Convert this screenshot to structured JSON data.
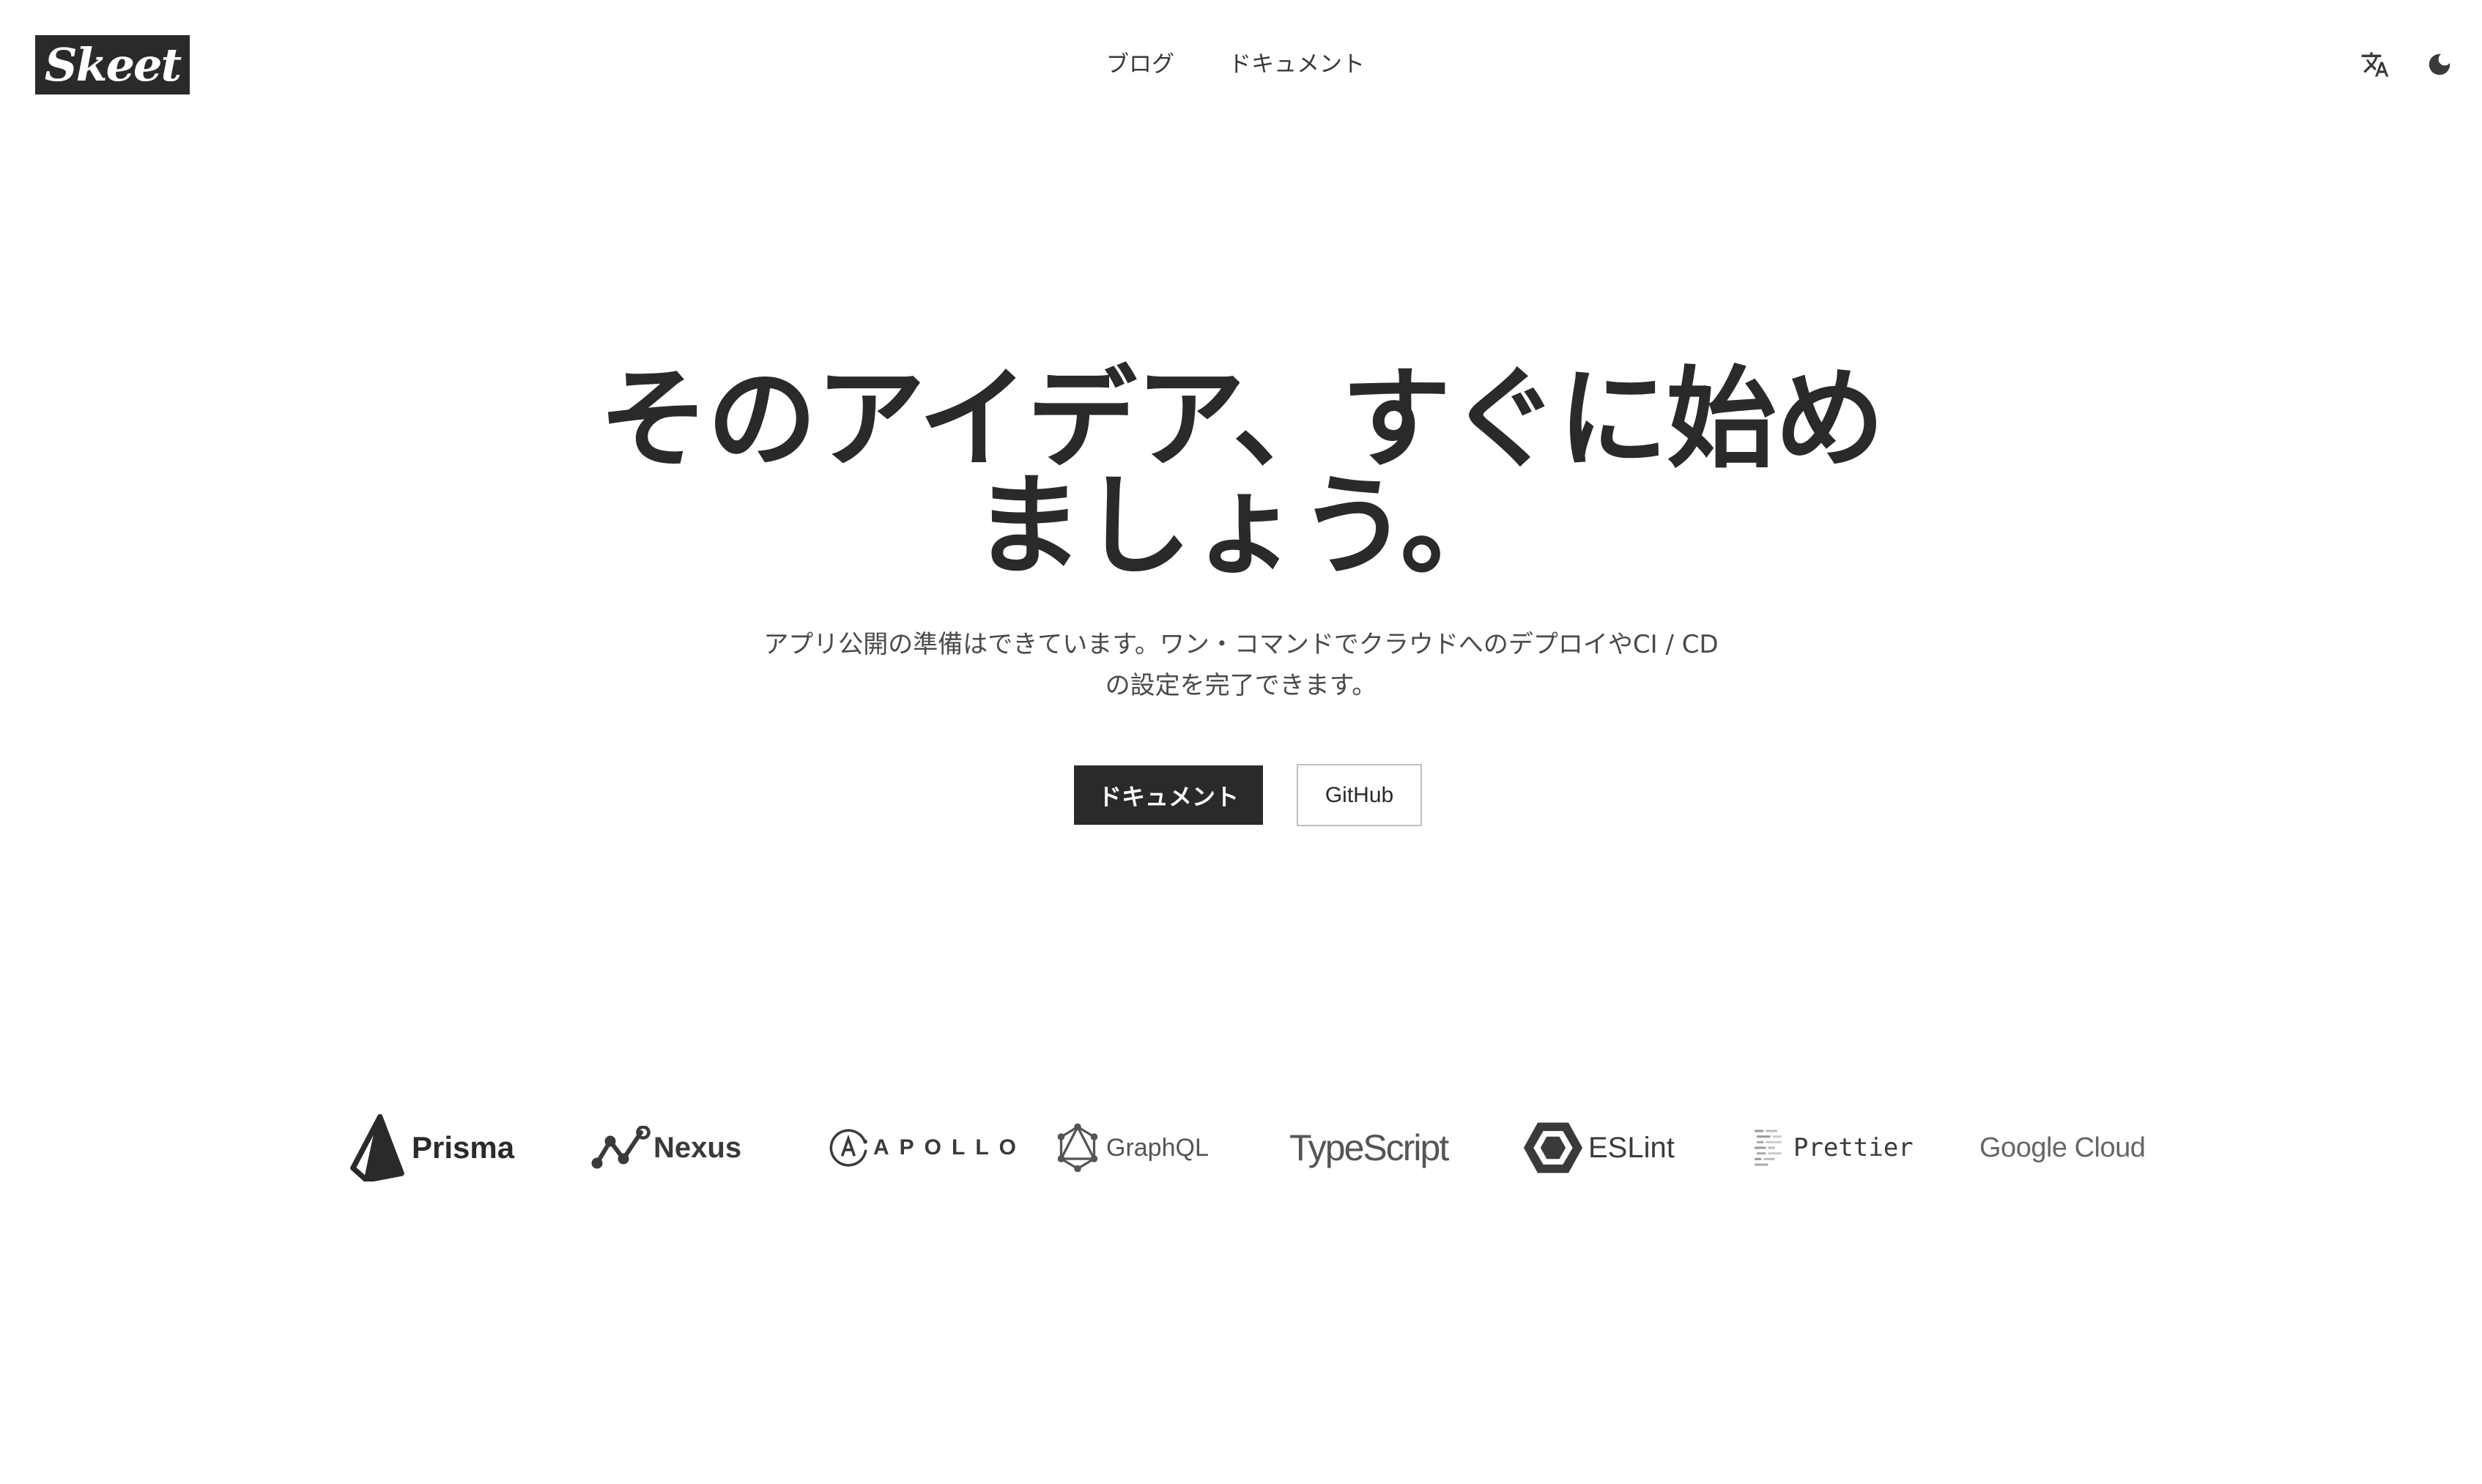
{
  "header": {
    "logo_text": "Skeet",
    "nav": [
      {
        "label": "ブログ"
      },
      {
        "label": "ドキュメント"
      }
    ],
    "translate_icon": "translate-icon",
    "theme_icon": "moon-icon"
  },
  "hero": {
    "title_line1": "そのアイデア、すぐに始め",
    "title_line2": "ましょう。",
    "desc_line1": "アプリ公開の準備はできています。ワン・コマンドでクラウドへのデプロイやCI / CD",
    "desc_line2": "の設定を完了できます。",
    "primary_button": "ドキュメント",
    "secondary_button": "GitHub"
  },
  "partners": [
    {
      "name": "Prisma",
      "icon": "prisma-icon"
    },
    {
      "name": "Nexus",
      "icon": "nexus-icon"
    },
    {
      "name": "APOLLO",
      "icon": "apollo-icon"
    },
    {
      "name": "GraphQL",
      "icon": "graphql-icon"
    },
    {
      "name": "TypeScript",
      "icon": "typescript-icon"
    },
    {
      "name": "ESLint",
      "icon": "eslint-icon"
    },
    {
      "name": "Prettier",
      "icon": "prettier-icon"
    },
    {
      "name": "Google Cloud",
      "icon": "google-cloud-icon"
    }
  ],
  "colors": {
    "primary": "#2b2a2b",
    "background": "#ffffff",
    "muted": "#4a4a4a"
  }
}
